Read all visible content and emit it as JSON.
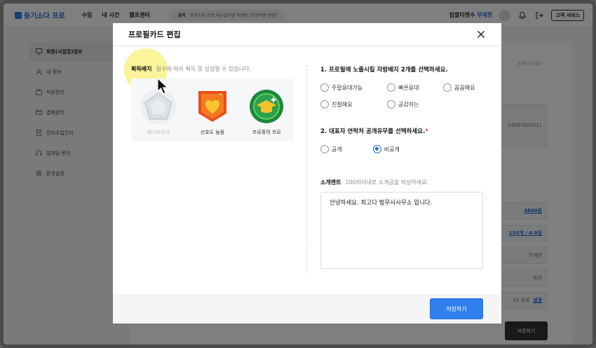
{
  "topbar": {
    "logo": "등기소다 프로",
    "nav": [
      "수임",
      "내 사건",
      "헬프센터"
    ],
    "notice_tag": "공지",
    "notice_text": "등기소다 프로 리뉴얼기념 이벤트 [기프티콘 증정]",
    "ticket_label": "입찰티켓수",
    "ticket_value": "무제한",
    "support": "고객 서비스"
  },
  "sidebar": {
    "items": [
      {
        "label": "회원(사업장)정보",
        "icon": "monitor-icon"
      },
      {
        "label": "내 정보",
        "icon": "person-icon"
      },
      {
        "label": "직원관리",
        "icon": "briefcase-icon"
      },
      {
        "label": "결제관리",
        "icon": "card-icon"
      },
      {
        "label": "전자수입인지",
        "icon": "document-icon"
      },
      {
        "label": "일대일 문의",
        "icon": "headset-icon"
      },
      {
        "label": "환경설정",
        "icon": "gear-icon"
      }
    ]
  },
  "background": {
    "hint": "원하시나요?",
    "number": "34567891011",
    "points": "4840점",
    "review": "150개 / 4.8점",
    "ticket": "무제한",
    "agree": "동의",
    "register": "01 등록",
    "setting": "설정",
    "save": "저장하기"
  },
  "modal": {
    "title": "프로필카드 편집",
    "badges_label": "획득배지",
    "badges_desc": "점수에 따라 획득 및 상실될 수 있습니다.",
    "badges": [
      {
        "label": "매너지킴이",
        "active": false
      },
      {
        "label": "선호도 높음",
        "active": true
      },
      {
        "label": "프로중의 프로",
        "active": true
      }
    ],
    "q1": "1. 프로필에 노출시킬 자랑배지 2개를 선택하세요.",
    "q1_options": [
      "주말응대가능",
      "빠른응대",
      "꼼꼼해요",
      "친절해요",
      "공감하는"
    ],
    "q2": "2. 대표자 연락처 공개유무를 선택하세요.",
    "q2_required": "*",
    "q2_options": [
      "공개",
      "비공개"
    ],
    "q2_selected": "비공개",
    "intro_label": "소개멘트",
    "intro_hint": "200자이내로 소개글을 작성하세요.",
    "intro_text": "안녕하세요. 최고다 법무사사무소 입니다.",
    "save": "저장하기"
  },
  "colors": {
    "accent": "#2f80ed",
    "brand": "#1f6fd6",
    "highlight": "#faf078"
  }
}
